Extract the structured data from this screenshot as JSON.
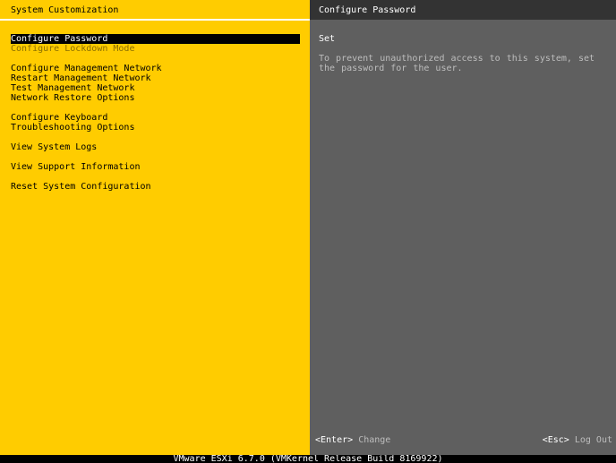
{
  "left": {
    "title": "System Customization",
    "items": [
      {
        "label": "Configure Password",
        "state": "selected"
      },
      {
        "label": "Configure Lockdown Mode",
        "state": "disabled"
      },
      {
        "label": "Configure Management Network",
        "state": "normal"
      },
      {
        "label": "Restart Management Network",
        "state": "normal"
      },
      {
        "label": "Test Management Network",
        "state": "normal"
      },
      {
        "label": "Network Restore Options",
        "state": "normal"
      },
      {
        "label": "Configure Keyboard",
        "state": "normal"
      },
      {
        "label": "Troubleshooting Options",
        "state": "normal"
      },
      {
        "label": "View System Logs",
        "state": "normal"
      },
      {
        "label": "View Support Information",
        "state": "normal"
      },
      {
        "label": "Reset System Configuration",
        "state": "normal"
      }
    ]
  },
  "right": {
    "title": "Configure Password",
    "subtitle": "Set",
    "description": "To prevent unauthorized access to this system, set the password for the user.",
    "footer_left": {
      "key": "<Enter>",
      "action": "Change"
    },
    "footer_right": {
      "key": "<Esc>",
      "action": "Log Out"
    }
  },
  "status_bar": "VMware ESXi 6.7.0 (VMKernel Release Build 8169922)",
  "colors": {
    "left_background": "#ffcc00",
    "right_background": "#5f5f5f",
    "selection_background": "#000000",
    "selection_text": "#ffffff"
  }
}
